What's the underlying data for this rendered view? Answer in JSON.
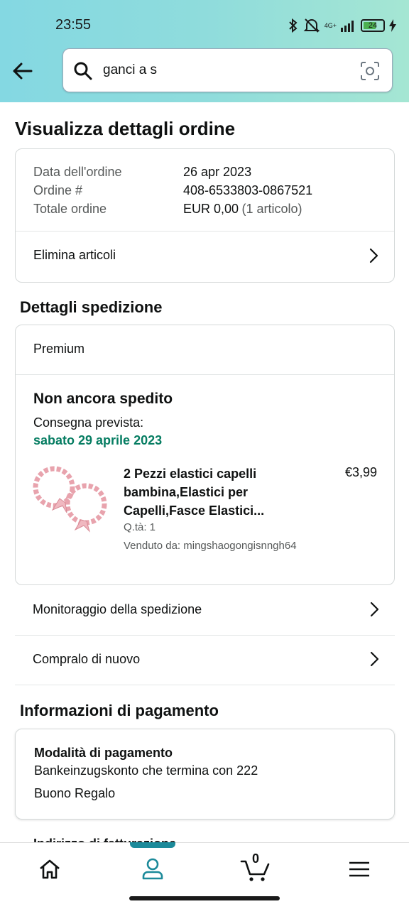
{
  "status_bar": {
    "time": "23:55",
    "network": "4G+",
    "battery": "24"
  },
  "search": {
    "query": "ganci a s"
  },
  "page": {
    "title": "Visualizza dettagli ordine"
  },
  "order_summary": {
    "rows": [
      {
        "label": "Data dell'ordine",
        "value": "26 apr 2023"
      },
      {
        "label": "Ordine #",
        "value": "408-6533803-0867521"
      },
      {
        "label": "Totale ordine",
        "value": "EUR 0,00",
        "extra": "(1 articolo)"
      }
    ],
    "delete_items": "Elimina articoli"
  },
  "shipping": {
    "section_title": "Dettagli spedizione",
    "service": "Premium",
    "status": "Non ancora spedito",
    "delivery_label": "Consegna prevista:",
    "delivery_date": "sabato 29 aprile 2023",
    "item": {
      "title_line1": "2 Pezzi elastici capelli",
      "title_line2": "bambina,Elastici per",
      "title_line3": "Capelli,Fasce Elastici...",
      "price": "€3,99",
      "qty": "Q.tà: 1",
      "seller": "Venduto da: mingshaogongisnngh64"
    },
    "track": "Monitoraggio della spedizione",
    "buy_again": "Compralo di nuovo"
  },
  "payment": {
    "section_title": "Informazioni di pagamento",
    "method_title": "Modalità di pagamento",
    "method_line1": "Bankeinzugskonto che termina con 222",
    "method_line2": "Buono Regalo",
    "billing_partial": "Indirizzo di fatturazione"
  },
  "bottom_nav": {
    "cart_count": "0"
  },
  "colors": {
    "accent": "#1c8a9a",
    "delivery_green": "#067d62"
  }
}
